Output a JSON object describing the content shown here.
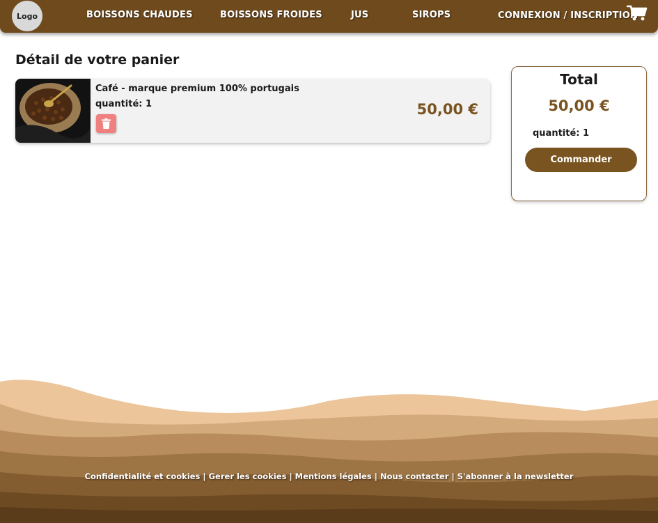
{
  "navbar": {
    "logo_label": "Logo",
    "links": [
      "BOISSONS CHAUDES",
      "BOISSONS FROIDES",
      "JUS",
      "SIROPS"
    ],
    "login_label": "CONNEXION / INSCRIPTION",
    "cart_icon": "shopping-cart-icon",
    "bg_color": "#6f4a1d"
  },
  "page": {
    "title": "Détail de votre panier"
  },
  "cart": {
    "items": [
      {
        "name": "Café - marque premium 100% portugais",
        "quantity": "quantité: 1",
        "price": "50,00 €",
        "delete_icon": "trash-icon"
      }
    ]
  },
  "summary": {
    "title": "Total",
    "price": "50,00 €",
    "quantity": "quantité: 1",
    "order_label": "Commander",
    "accent_color": "#7a5420"
  },
  "footer": {
    "links": [
      "Confidentialité et cookies",
      "Gerer les cookies",
      "Mentions légales",
      "Nous contacter",
      "S'abonner à la newsletter"
    ],
    "separator": "|"
  }
}
